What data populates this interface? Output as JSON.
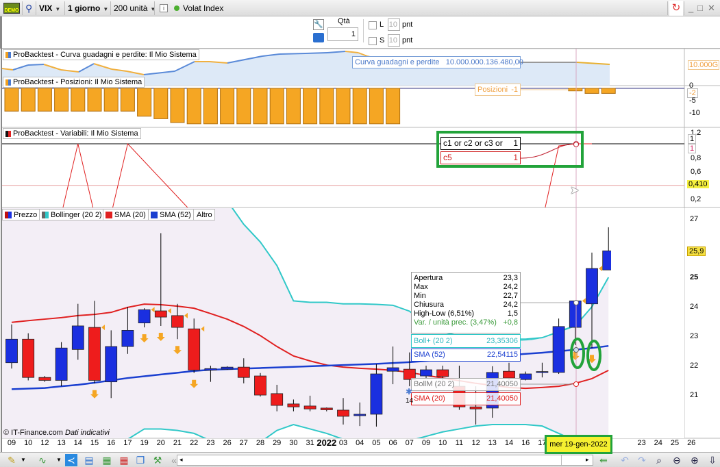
{
  "toolbar": {
    "symbol": "VIX",
    "timeframe": "1 giorno",
    "units": "200 unità",
    "instrument_name": "Volat Index",
    "status_color": "#4caf30",
    "icons": [
      "demo-icon",
      "pin-icon",
      "info-icon",
      "refresh-arrows-icon",
      "minimize-icon",
      "maximize-icon",
      "close-icon"
    ],
    "demo_badge": "DEMO"
  },
  "order": {
    "qty_label": "Qtà",
    "qty_value": "1",
    "long_label": "L",
    "long_value": "10",
    "short_label": "S",
    "short_value": "10",
    "unit": "pnt"
  },
  "panes": {
    "equity": {
      "label": "ProBacktest - Curva guadagni e perdite: Il Mio Sistema",
      "tip_label": "Curva guadagni e perdite",
      "tip_value": "10.000.000.136.480,00",
      "axis_label": "10.000G"
    },
    "positions": {
      "label": "ProBacktest - Posizioni: Il Mio Sistema",
      "tip_label": "Posizioni",
      "tip_value": "-1",
      "axis_ticks": [
        "0",
        "-5",
        "-10"
      ],
      "axis_marker": "-2",
      "values": [
        -9,
        -9,
        -9,
        -9,
        -9,
        -9,
        -9,
        -9,
        -11,
        -12,
        -13.5,
        -14,
        -14,
        -14,
        -14,
        -14,
        -14,
        -14,
        -14,
        -14,
        -14,
        -14,
        -14,
        -14,
        0,
        0,
        0,
        0,
        0,
        0,
        0,
        0,
        0,
        0,
        -1,
        -2,
        -2
      ]
    },
    "variables": {
      "label": "ProBacktest - Variabili: Il Mio Sistema",
      "row1_label": "c1 or c2 or c3 or c4",
      "row1_value": "1",
      "row2_label": "c5",
      "row2_value": "1",
      "axis_ticks": [
        "1,2",
        "0,8",
        "0,6",
        "0,2"
      ],
      "axis_marker_1": "1",
      "axis_marker_2": "1",
      "crosshair_value": "0,410",
      "c1_c4": 1,
      "c5": [
        0,
        0,
        0,
        0,
        1,
        0,
        0,
        1,
        0.75,
        0.5,
        0.25,
        0,
        0,
        0,
        0,
        0,
        0,
        0,
        0,
        0,
        0,
        0,
        0,
        0,
        0,
        0,
        0,
        0,
        0,
        0,
        0,
        0,
        -0.1,
        0.97,
        1,
        1,
        null
      ]
    }
  },
  "legend": [
    {
      "label": "Prezzo",
      "color": "#c01010"
    },
    {
      "label": "Bollinger (20 2)",
      "color": "#30c8c8"
    },
    {
      "label": "SMA (20)",
      "color": "#e02020"
    },
    {
      "label": "SMA (52)",
      "color": "#1a3fd0"
    },
    {
      "label": "Altro",
      "color": ""
    }
  ],
  "tooltip": {
    "rows": [
      {
        "label": "Apertura",
        "value": "23,3"
      },
      {
        "label": "Max",
        "value": "24,2"
      },
      {
        "label": "Min",
        "value": "22,7"
      },
      {
        "label": "Chiusura",
        "value": "24,2"
      },
      {
        "label": "High-Low (6,51%)",
        "value": "1,5"
      },
      {
        "label": "Var. / unità prec. (3,47%)",
        "value": "+0,8"
      }
    ],
    "bollp": {
      "label": "Boll+ (20 2)",
      "value": "23,35306"
    },
    "sma52": {
      "label": "SMA (52)",
      "value": "22,54115"
    },
    "bollm": {
      "label": "BollM (20 2)",
      "value": "21,40050"
    },
    "sma20": {
      "label": "SMA (20)",
      "value": "21,40050"
    },
    "marker_text": "14"
  },
  "copyright": "© IT-Finance.com",
  "disclaimer": "Dati indicativi",
  "crosshair_date": "mer 19-gen-2022",
  "colors": {
    "up": "#1a2fe0",
    "down": "#ee1c1c",
    "sma20": "#e02020",
    "sma52": "#1a3fd0",
    "bollinger": "#30c8c8",
    "highlight": "#22a33a",
    "band_fill": "#f3eef6"
  },
  "chart_data": {
    "type": "candlestick",
    "categories": [
      "09",
      "10",
      "12",
      "13",
      "14",
      "15",
      "16",
      "17",
      "19",
      "20",
      "21",
      "22",
      "23",
      "26",
      "27",
      "28",
      "29",
      "30",
      "31",
      "2022",
      "03",
      "04",
      "05",
      "06",
      "07",
      "09",
      "10",
      "11",
      "12",
      "13",
      "14",
      "16",
      "17",
      "18",
      "19",
      "20",
      "21"
    ],
    "future_categories": [
      "23",
      "24",
      "25",
      "26"
    ],
    "y_ticks": [
      "27",
      "25",
      "24",
      "23",
      "22",
      "21"
    ],
    "last_price": "25,9",
    "ylim": [
      19.5,
      27.3
    ],
    "ohlc": [
      [
        22.1,
        23.4,
        21.9,
        22.9
      ],
      [
        22.9,
        23.1,
        21.5,
        21.6
      ],
      [
        21.6,
        21.65,
        21.45,
        21.5
      ],
      [
        21.5,
        22.8,
        21.3,
        22.6
      ],
      [
        22.55,
        24.1,
        22.2,
        23.35
      ],
      [
        23.3,
        24.2,
        21.4,
        21.5
      ],
      [
        21.45,
        23.2,
        20.9,
        22.65
      ],
      [
        22.65,
        24.0,
        22.4,
        23.2
      ],
      [
        23.45,
        23.95,
        23.3,
        23.9
      ],
      [
        23.86,
        26.5,
        23.35,
        23.65
      ],
      [
        23.7,
        24.1,
        22.9,
        23.3
      ],
      [
        23.25,
        23.6,
        21.75,
        21.85
      ],
      [
        21.85,
        22.0,
        21.45,
        21.9
      ],
      [
        21.88,
        21.98,
        21.86,
        21.95
      ],
      [
        21.95,
        22.25,
        21.4,
        21.6
      ],
      [
        21.65,
        21.75,
        20.95,
        21.0
      ],
      [
        21.05,
        21.35,
        20.45,
        20.65
      ],
      [
        20.7,
        20.85,
        20.45,
        20.6
      ],
      [
        20.63,
        20.98,
        20.45,
        20.53
      ],
      [
        20.56,
        20.58,
        20.45,
        20.5
      ],
      [
        20.49,
        20.9,
        20.0,
        20.28
      ],
      [
        20.3,
        20.75,
        19.95,
        20.35
      ],
      [
        20.35,
        22.05,
        19.93,
        21.72
      ],
      [
        21.81,
        22.65,
        21.37,
        21.93
      ],
      [
        21.88,
        22.45,
        21.3,
        21.53
      ],
      [
        21.65,
        22.0,
        21.55,
        21.86
      ],
      [
        21.86,
        22.0,
        21.5,
        21.63
      ],
      [
        21.3,
        22.0,
        20.5,
        20.6
      ],
      [
        20.6,
        21.3,
        20.0,
        20.53
      ],
      [
        20.56,
        21.98,
        20.23,
        21.77
      ],
      [
        21.81,
        22.1,
        21.5,
        21.58
      ],
      [
        21.53,
        21.8,
        21.5,
        21.72
      ],
      [
        21.78,
        22.1,
        21.6,
        21.8
      ],
      [
        21.77,
        23.6,
        21.72,
        23.33
      ],
      [
        23.3,
        24.2,
        22.7,
        24.2
      ],
      [
        24.1,
        25.84,
        22.6,
        25.3
      ],
      [
        25.25,
        26.7,
        25.25,
        25.9
      ]
    ],
    "signals_short": [
      5,
      8,
      9,
      10,
      11,
      34,
      35
    ],
    "sma20": [
      23.47,
      23.53,
      23.58,
      23.63,
      23.7,
      23.74,
      23.81,
      23.98,
      24.09,
      24.07,
      24.02,
      23.95,
      23.77,
      23.58,
      23.33,
      23.02,
      22.65,
      22.33,
      22.16,
      22.02,
      21.95,
      21.91,
      21.88,
      21.84,
      21.77,
      21.67,
      21.58,
      21.49,
      21.4,
      21.33,
      21.26,
      21.23,
      21.26,
      21.3,
      21.4,
      21.56,
      21.84
    ],
    "sma52": [
      21.2,
      21.22,
      21.24,
      21.3,
      21.35,
      21.42,
      21.5,
      21.58,
      21.64,
      21.7,
      21.76,
      21.82,
      21.86,
      21.88,
      21.9,
      21.92,
      21.94,
      21.96,
      21.98,
      22.0,
      22.02,
      22.04,
      22.06,
      22.09,
      22.12,
      22.16,
      22.2,
      22.24,
      22.28,
      22.32,
      22.36,
      22.4,
      22.44,
      22.49,
      22.54,
      22.6,
      22.67
    ],
    "boll_upper": [
      null,
      null,
      null,
      null,
      null,
      null,
      null,
      null,
      null,
      null,
      null,
      null,
      null,
      27.6,
      26.8,
      26.2,
      25.4,
      24.2,
      24.15,
      24.15,
      24.1,
      24.1,
      24.08,
      24.05,
      23.85,
      23.4,
      23.15,
      23.0,
      22.95,
      22.92,
      22.9,
      22.9,
      22.95,
      23.15,
      23.35,
      24.0,
      25.0
    ],
    "boll_lower": [
      null,
      null,
      null,
      null,
      null,
      null,
      null,
      19.5,
      19.85,
      19.85,
      19.8,
      19.7,
      19.45,
      19.3,
      19.3,
      19.4,
      19.8,
      20.0,
      19.85,
      19.7,
      19.5,
      19.3,
      19.2,
      19.3,
      19.45,
      19.6,
      19.75,
      19.85,
      19.95,
      20.0,
      20.0,
      20.0,
      19.95,
      19.7,
      19.45,
      19.3,
      19.2
    ]
  }
}
